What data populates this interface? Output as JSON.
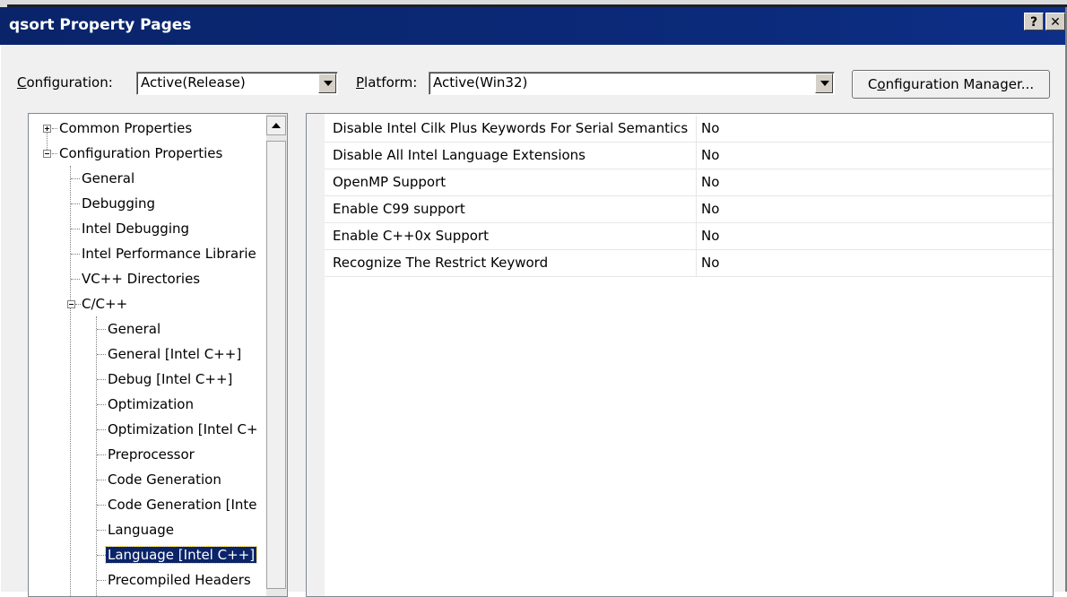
{
  "window": {
    "title": "qsort Property Pages",
    "help_label": "?",
    "close_label": "✕"
  },
  "toolbar": {
    "configuration_label_accel": "C",
    "configuration_label_rest": "onfiguration:",
    "configuration_value": "Active(Release)",
    "platform_label_accel": "P",
    "platform_label_rest": "latform:",
    "platform_value": "Active(Win32)",
    "config_manager_pre": "C",
    "config_manager_accel": "o",
    "config_manager_post": "nfiguration Manager..."
  },
  "tree": {
    "items": [
      {
        "label": "Common Properties"
      },
      {
        "label": "Configuration Properties"
      },
      {
        "label": "General"
      },
      {
        "label": "Debugging"
      },
      {
        "label": "Intel Debugging"
      },
      {
        "label": "Intel Performance Librarie"
      },
      {
        "label": "VC++ Directories"
      },
      {
        "label": "C/C++"
      },
      {
        "label": "General"
      },
      {
        "label": "General [Intel C++]"
      },
      {
        "label": "Debug [Intel C++]"
      },
      {
        "label": "Optimization"
      },
      {
        "label": "Optimization [Intel C+"
      },
      {
        "label": "Preprocessor"
      },
      {
        "label": "Code Generation"
      },
      {
        "label": "Code Generation [Inte"
      },
      {
        "label": "Language"
      },
      {
        "label": "Language [Intel C++]"
      },
      {
        "label": "Precompiled Headers"
      }
    ]
  },
  "properties": [
    {
      "name": "Disable Intel Cilk Plus Keywords For Serial Semantics",
      "value": "No"
    },
    {
      "name": "Disable All Intel Language Extensions",
      "value": "No"
    },
    {
      "name": "OpenMP Support",
      "value": "No"
    },
    {
      "name": "Enable C99 support",
      "value": "No"
    },
    {
      "name": "Enable C++0x Support",
      "value": "No"
    },
    {
      "name": "Recognize The Restrict Keyword",
      "value": "No"
    }
  ]
}
